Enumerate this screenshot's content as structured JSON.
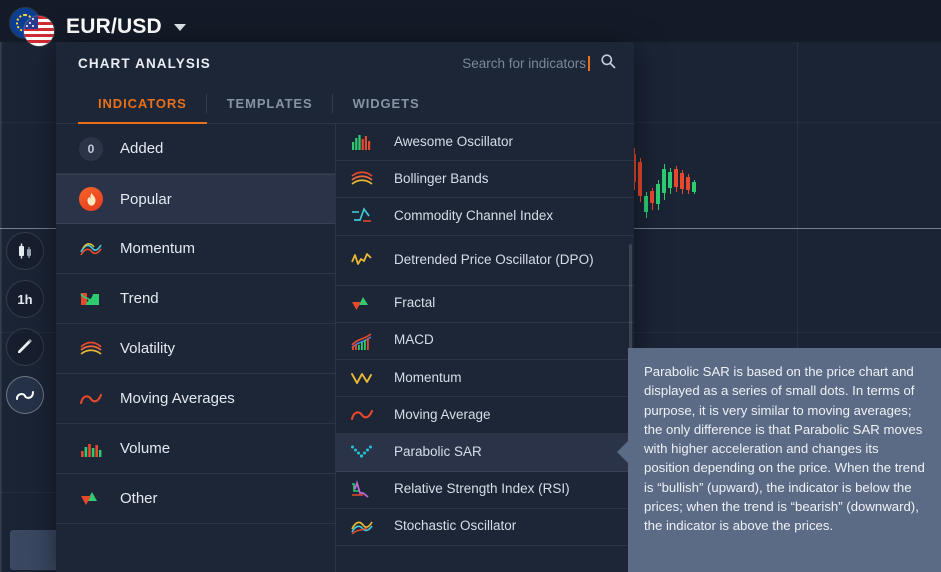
{
  "symbol": {
    "name": "EUR/USD",
    "caret_icon": "chevron-down-icon",
    "flag_left": "eu-flag-icon",
    "flag_right": "us-flag-icon"
  },
  "left_toolbar": {
    "items": [
      {
        "name": "candlestick-chart-type",
        "label": "",
        "icon": "candlestick-icon",
        "active": false
      },
      {
        "name": "timeframe",
        "label": "1h",
        "icon": "",
        "active": false
      },
      {
        "name": "drawing-tools",
        "label": "",
        "icon": "pencil-icon",
        "active": false
      },
      {
        "name": "indicators",
        "label": "",
        "icon": "wave-icon",
        "active": true
      }
    ]
  },
  "modal": {
    "title": "CHART ANALYSIS",
    "search": {
      "placeholder": "Search for indicators",
      "value": "",
      "icon": "search-icon"
    },
    "tabs": [
      {
        "label": "INDICATORS",
        "active": true
      },
      {
        "label": "TEMPLATES",
        "active": false
      },
      {
        "label": "WIDGETS",
        "active": false
      }
    ],
    "categories": [
      {
        "label": "Added",
        "icon": "count-badge",
        "badge": "0",
        "selected": false
      },
      {
        "label": "Popular",
        "icon": "fire-icon",
        "selected": true
      },
      {
        "label": "Momentum",
        "icon": "momentum-icon",
        "selected": false
      },
      {
        "label": "Trend",
        "icon": "trend-icon",
        "selected": false
      },
      {
        "label": "Volatility",
        "icon": "volatility-icon",
        "selected": false
      },
      {
        "label": "Moving Averages",
        "icon": "moving-average-icon",
        "selected": false
      },
      {
        "label": "Volume",
        "icon": "volume-icon",
        "selected": false
      },
      {
        "label": "Other",
        "icon": "other-icon",
        "selected": false
      }
    ],
    "indicators": [
      {
        "label": "Awesome Oscillator",
        "icon": "awesome-oscillator-icon",
        "selected": false,
        "two_line": false
      },
      {
        "label": "Bollinger Bands",
        "icon": "bollinger-bands-icon",
        "selected": false,
        "two_line": false
      },
      {
        "label": "Commodity Channel Index",
        "icon": "cci-icon",
        "selected": false,
        "two_line": false
      },
      {
        "label": "Detrended Price Oscillator (DPO)",
        "icon": "dpo-icon",
        "selected": false,
        "two_line": true
      },
      {
        "label": "Fractal",
        "icon": "fractal-icon",
        "selected": false,
        "two_line": false
      },
      {
        "label": "MACD",
        "icon": "macd-icon",
        "selected": false,
        "two_line": false
      },
      {
        "label": "Momentum",
        "icon": "momentum-indicator-icon",
        "selected": false,
        "two_line": false
      },
      {
        "label": "Moving Average",
        "icon": "moving-average-indicator-icon",
        "selected": false,
        "two_line": false
      },
      {
        "label": "Parabolic SAR",
        "icon": "parabolic-sar-icon",
        "selected": true,
        "two_line": false
      },
      {
        "label": "Relative Strength Index (RSI)",
        "icon": "rsi-icon",
        "selected": false,
        "two_line": false
      },
      {
        "label": "Stochastic Oscillator",
        "icon": "stochastic-oscillator-icon",
        "selected": false,
        "two_line": false
      }
    ]
  },
  "tooltip": {
    "text": "Parabolic SAR is based on the price chart and displayed as a series of small dots. In terms of purpose, it is very similar to moving averages; the only difference is that Parabolic SAR moves with higher acceleration and changes its position depending on the price. When the trend is “bullish” (upward), the indicator is below the prices; when the trend is “bearish” (downward), the indicator is above the prices."
  },
  "colors": {
    "accent": "#e8701a",
    "bull": "#2ecc71",
    "bear": "#e8482b",
    "panel": "#1d2636",
    "selected_row": "#2a3348",
    "tooltip_bg": "#5b6b85",
    "chart_bg": "#1b2435"
  }
}
